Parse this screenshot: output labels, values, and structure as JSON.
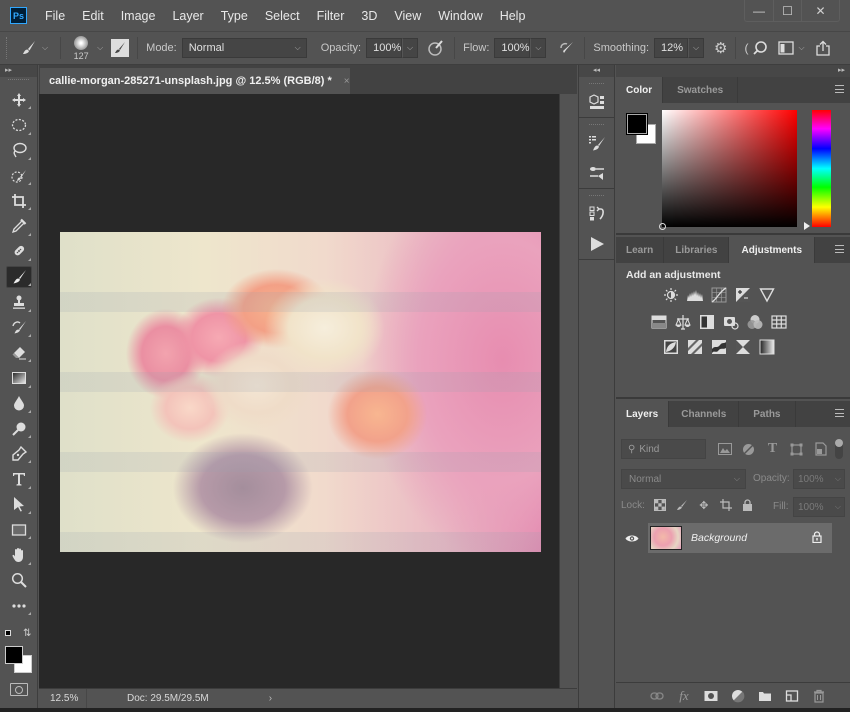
{
  "app": {
    "logo": "Ps"
  },
  "menu": [
    "File",
    "Edit",
    "Image",
    "Layer",
    "Type",
    "Select",
    "Filter",
    "3D",
    "View",
    "Window",
    "Help"
  ],
  "window_controls": {
    "minimize": "—",
    "maximize": "☐",
    "close": "✕"
  },
  "options_bar": {
    "brush_size": "127",
    "mode_label": "Mode:",
    "mode_value": "Normal",
    "opacity_label": "Opacity:",
    "opacity_value": "100%",
    "flow_label": "Flow:",
    "flow_value": "100%",
    "smoothing_label": "Smoothing:",
    "smoothing_value": "12%",
    "paren": "("
  },
  "document": {
    "tab_title": "callie-morgan-285271-unsplash.jpg @ 12.5% (RGB/8) *",
    "close": "×",
    "zoom": "12.5%",
    "doc_size": "Doc: 29.5M/29.5M",
    "status_arrow": "›"
  },
  "toolbar": {
    "collapse": "▸▸",
    "tools": [
      "move",
      "marquee",
      "lasso",
      "quick-selection",
      "crop",
      "eyedropper",
      "healing-brush",
      "brush",
      "clone-stamp",
      "history-brush",
      "eraser",
      "gradient",
      "blur",
      "dodge",
      "pen",
      "type",
      "path-selection",
      "rectangle",
      "hand",
      "zoom",
      "more-tools"
    ],
    "active_tool": "brush",
    "foreground_color": "#000000",
    "background_color": "#ffffff"
  },
  "dock": {
    "collapse": "◂◂"
  },
  "panels": {
    "expand": "▸▸",
    "color": {
      "tabs": [
        "Color",
        "Swatches"
      ],
      "active_tab": "Color",
      "foreground": "#000000",
      "background": "#ffffff",
      "hue": "#ff0000"
    },
    "adjustments": {
      "tabs": [
        "Learn",
        "Libraries",
        "Adjustments"
      ],
      "active_tab": "Adjustments",
      "title": "Add an adjustment",
      "rows": [
        [
          "brightness-contrast",
          "levels",
          "curves",
          "exposure",
          "vibrance"
        ],
        [
          "hue-saturation",
          "color-balance",
          "black-white",
          "photo-filter",
          "channel-mixer",
          "color-lookup"
        ],
        [
          "invert",
          "posterize",
          "threshold",
          "selective-color",
          "gradient-map"
        ]
      ]
    },
    "layers": {
      "tabs": [
        "Layers",
        "Channels",
        "Paths"
      ],
      "active_tab": "Layers",
      "kind_placeholder": "Kind",
      "blend_mode": "Normal",
      "opacity_label": "Opacity:",
      "opacity_value": "100%",
      "lock_label": "Lock:",
      "fill_label": "Fill:",
      "fill_value": "100%",
      "items": [
        {
          "name": "Background",
          "visible": true,
          "locked": true
        }
      ]
    }
  }
}
